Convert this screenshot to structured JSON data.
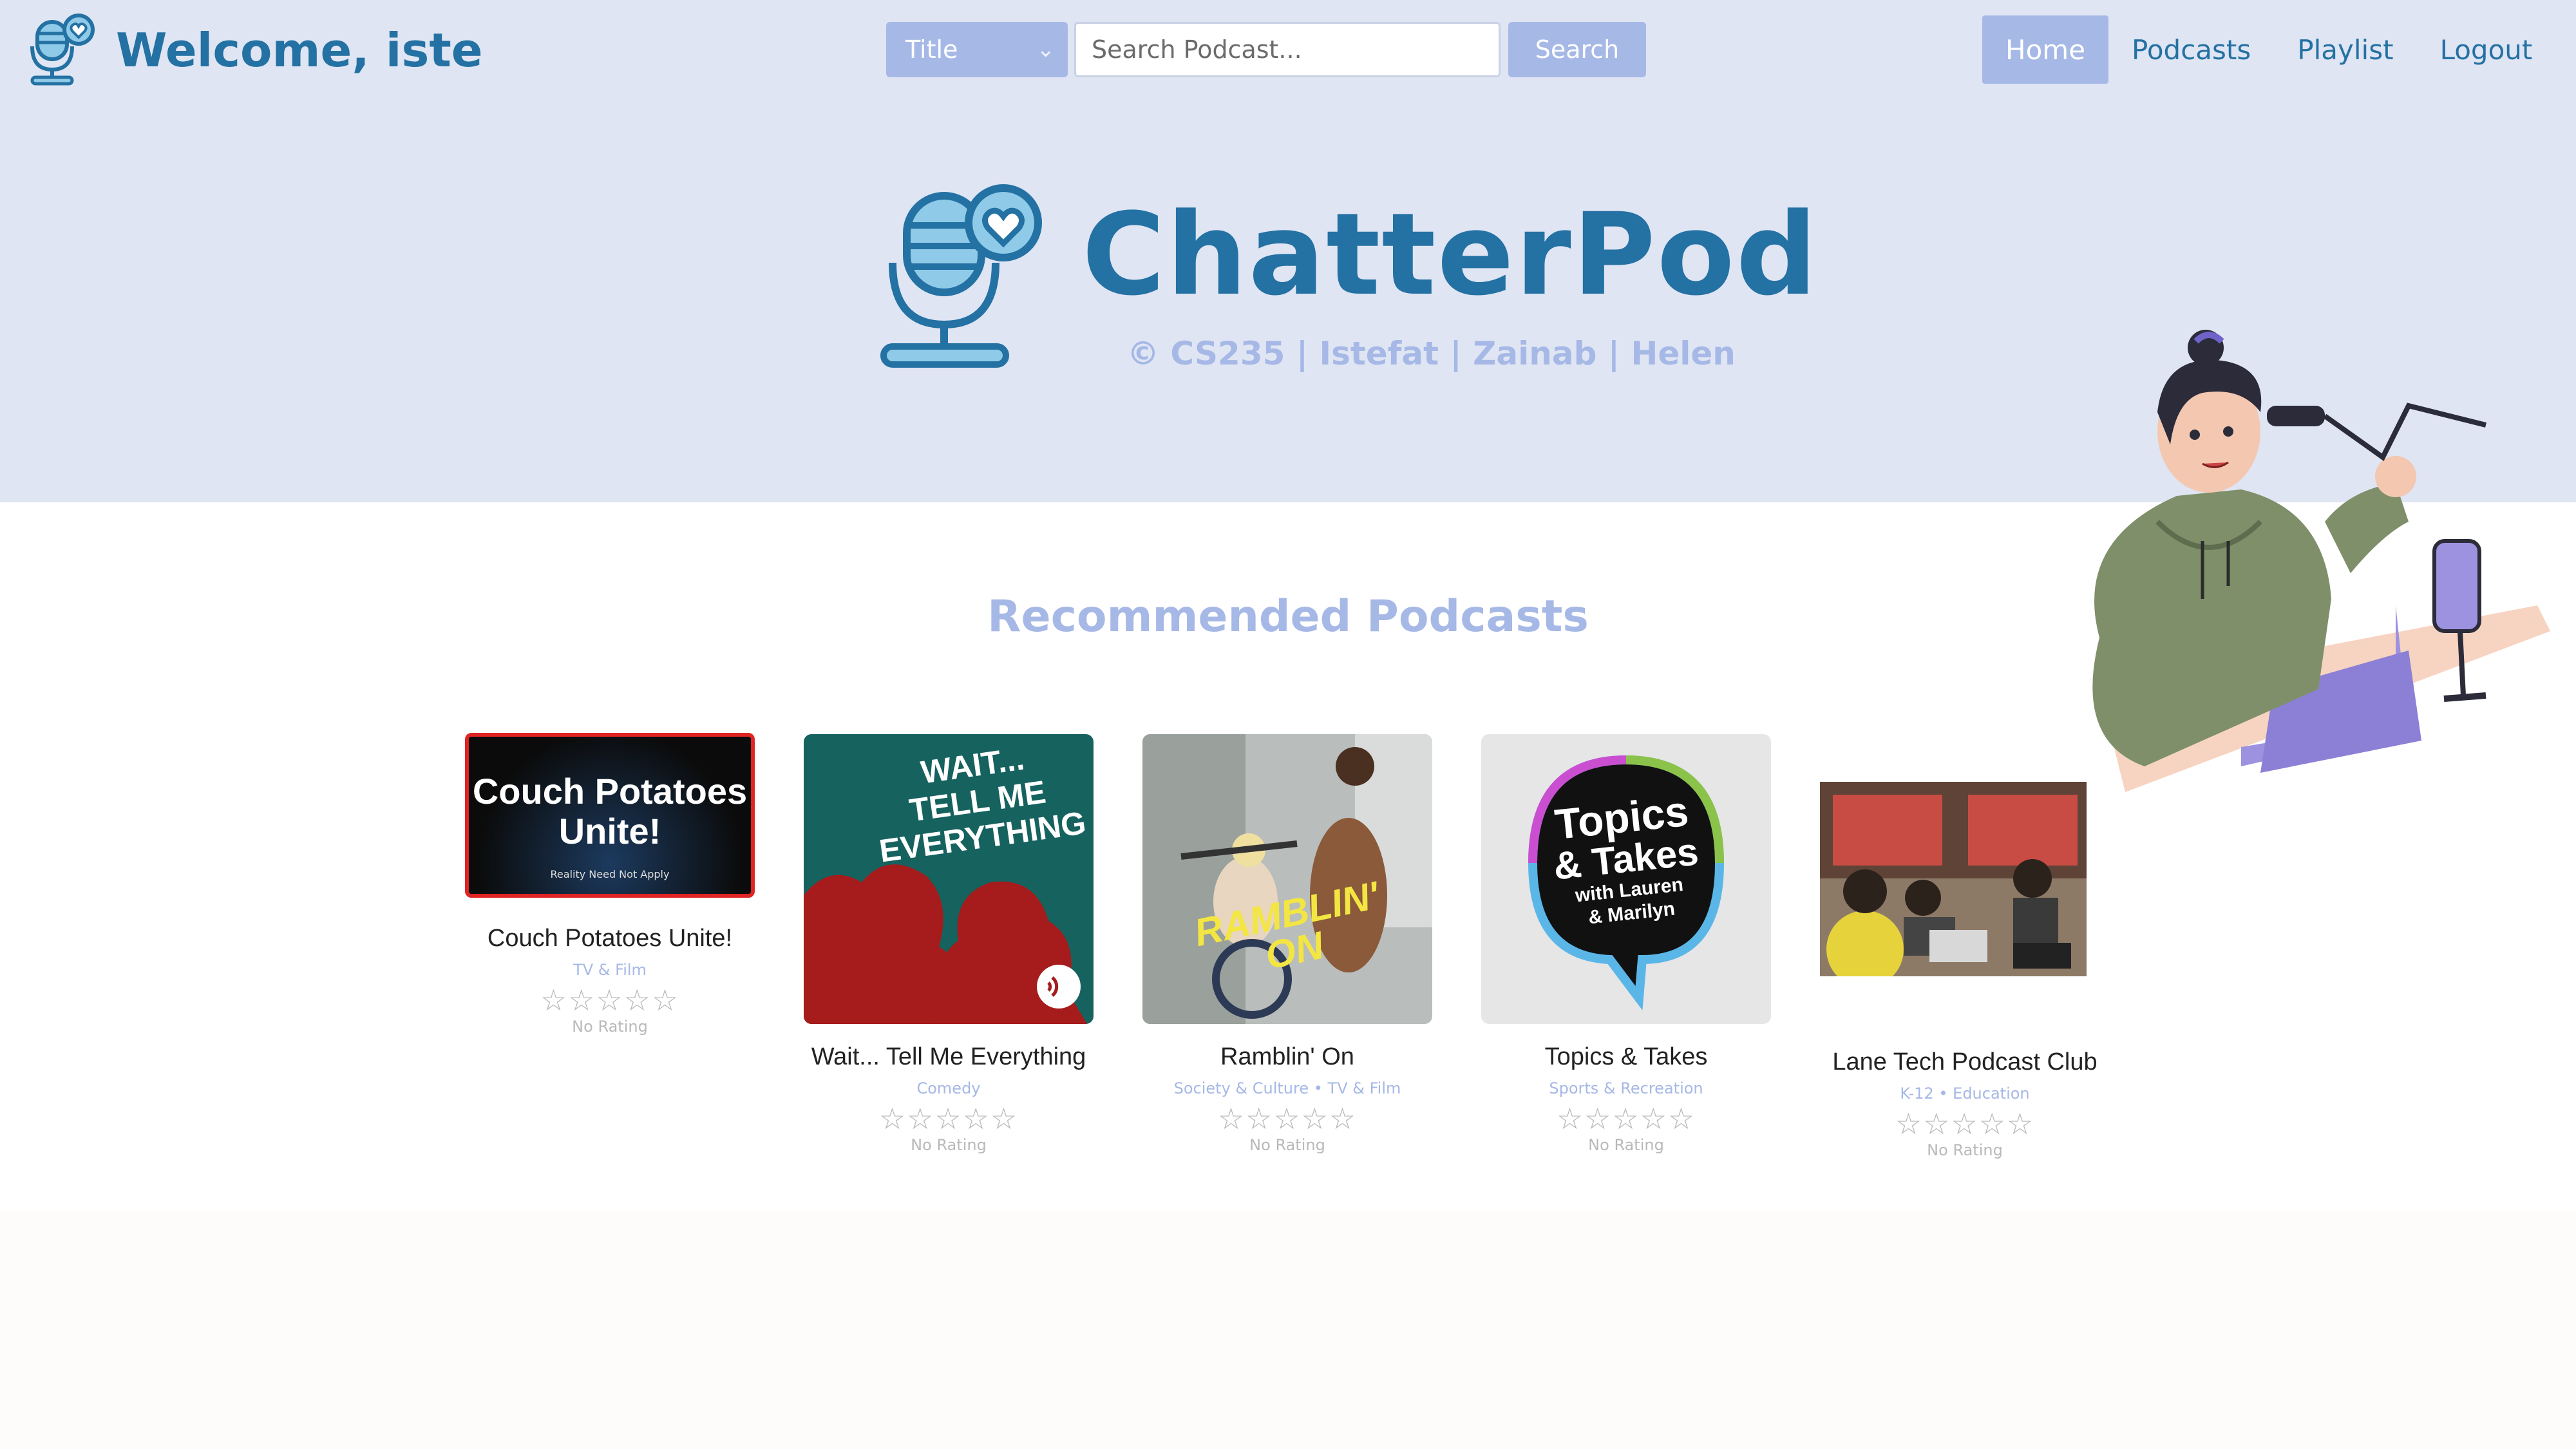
{
  "header": {
    "welcome": "Welcome, iste",
    "search": {
      "filter_value": "Title",
      "placeholder": "Search Podcast...",
      "button_label": "Search"
    },
    "nav": [
      "Home",
      "Podcasts",
      "Playlist",
      "Logout"
    ],
    "active_nav": "Home"
  },
  "hero": {
    "title": "ChatterPod",
    "subtitle": "© CS235 | Istefat | Zainab | Helen"
  },
  "recommended": {
    "title": "Recommended Podcasts",
    "cards": [
      {
        "title": "Couch Potatoes Unite!",
        "category": "TV & Film",
        "rating": "No Rating",
        "cover_text": [
          "Couch Potatoes",
          "Unite!"
        ],
        "cover_small": "Reality Need Not Apply"
      },
      {
        "title": "Wait... Tell Me Everything",
        "category": "Comedy",
        "rating": "No Rating",
        "cover_text": [
          "WAIT...",
          "TELL ME",
          "EVERYTHING"
        ]
      },
      {
        "title": "Ramblin' On",
        "category": "Society & Culture • TV & Film",
        "rating": "No Rating",
        "cover_text": [
          "RAMBLIN'",
          "ON"
        ]
      },
      {
        "title": "Topics & Takes",
        "category": "Sports & Recreation",
        "rating": "No Rating",
        "cover_text": [
          "Topics",
          "& Takes",
          "with Lauren",
          "& Marilyn"
        ]
      },
      {
        "title": "Lane Tech Podcast Club",
        "category": "K-12 • Education",
        "rating": "No Rating"
      }
    ]
  },
  "colors": {
    "brand_blue": "#2471a3",
    "accent_periwinkle": "#a6b8e6",
    "header_bg": "#dfe5f3",
    "star_gray": "#b9b9b9",
    "selected_card_border": "#e02424"
  },
  "icons": [
    "microphone-heart-icon",
    "chevron-down-icon",
    "star-icon",
    "podcast-rss-icon"
  ]
}
